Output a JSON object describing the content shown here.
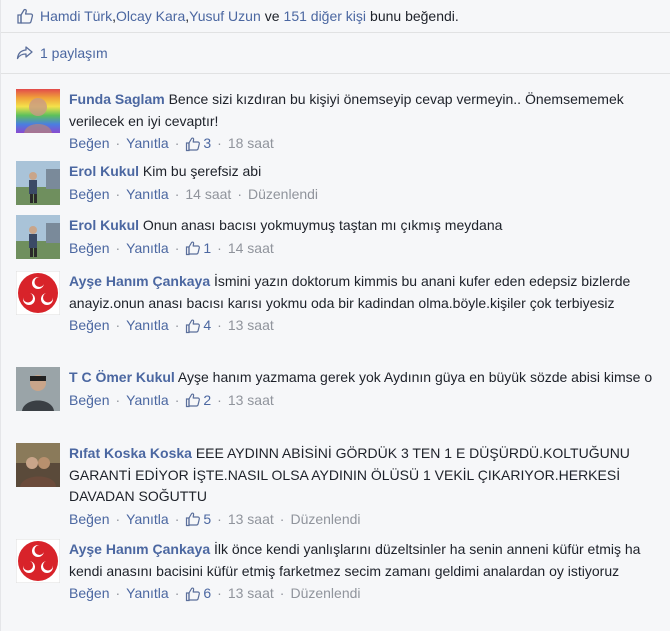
{
  "likes": {
    "names": [
      "Hamdi Türk",
      "Olcay Kara",
      "Yusuf Uzun"
    ],
    "separator": ", ",
    "conj": "ve",
    "others": "151 diğer kişi",
    "suffix": "bunu beğendi."
  },
  "shares": {
    "label": "1 paylaşım"
  },
  "actions": {
    "like": "Beğen",
    "reply": "Yanıtla",
    "edited": "Düzenlendi",
    "dot": "·"
  },
  "comments": [
    {
      "name": "Funda Saglam",
      "text": "Bence sizi kızdıran bu kişiyi önemseyip cevap vermeyin.. Önemsememek verilecek en iyi cevaptır!",
      "likes": "3",
      "time": "18 saat",
      "edited": false,
      "avatar": "rainbow"
    },
    {
      "name": "Erol Kukul",
      "text": "Kim bu şerefsiz abi",
      "likes": "",
      "time": "14 saat",
      "edited": true,
      "avatar": "outdoor"
    },
    {
      "name": "Erol Kukul",
      "text": "Onun anası bacısı yokmuymuş taştan mı çıkmış meydana",
      "likes": "1",
      "time": "14 saat",
      "edited": false,
      "avatar": "outdoor"
    },
    {
      "name": "Ayşe Hanım Çankaya",
      "text": "İsmini yazın doktorum kimmis bu anani kufer eden edepsiz bizlerde anayiz.onun anası bacısı karısı yokmu oda bir kadindan olma.böyle.kişiler çok terbiyesiz",
      "likes": "4",
      "time": "13 saat",
      "edited": false,
      "avatar": "crescents"
    },
    {
      "name": "T C Ömer Kukul",
      "text": "Ayşe hanım yazmama gerek yok Aydının güya en büyük sözde abisi kimse o",
      "likes": "2",
      "time": "13 saat",
      "edited": false,
      "avatar": "person"
    },
    {
      "name": "Rıfat Koska Koska",
      "text": "EEE AYDINN ABİSİNİ GÖRDÜK 3 TEN 1 E DÜŞÜRDÜ.KOLTUĞUNU GARANTİ EDİYOR İŞTE.NASIL OLSA AYDININ ÖLÜSÜ 1 VEKİL ÇIKARIYOR.HERKESİ DAVADAN SOĞUTTU",
      "likes": "5",
      "time": "13 saat",
      "edited": true,
      "avatar": "dark"
    },
    {
      "name": "Ayşe Hanım Çankaya",
      "text": "İlk önce kendi yanlışlarını düzeltsinler ha senin anneni küfür etmiş ha kendi anasını bacisini küfür etmiş farketmez secim zamanı geldimi analardan oy istiyoruz",
      "likes": "6",
      "time": "13 saat",
      "edited": true,
      "avatar": "crescents"
    }
  ]
}
